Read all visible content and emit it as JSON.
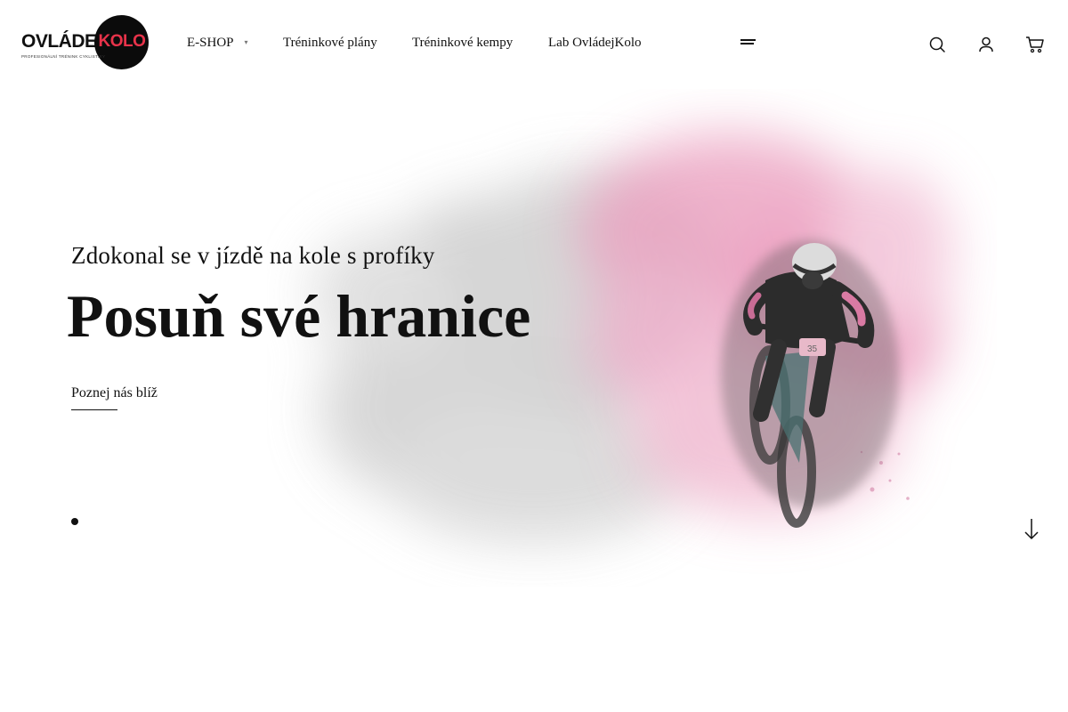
{
  "header": {
    "logo": {
      "text_left": "OVLÁDEJ",
      "text_right": "KOLO",
      "tagline": "PROFESIONÁLNÍ TRÉNINK CYKLISTIKY",
      "brand_color": "#e8334a"
    },
    "nav": {
      "eshop": "E-SHOP",
      "eshop_caret": "▾",
      "plans": "Tréninkové plány",
      "camps": "Tréninkové kempy",
      "lab": "Lab OvládejKolo"
    },
    "icons": {
      "menu": "menu-icon",
      "search": "search-icon",
      "account": "user-icon",
      "cart": "cart-icon"
    }
  },
  "hero": {
    "subtitle": "Zdokonal se v jízdě na kole s profíky",
    "headline": "Posuň své hranice",
    "cta_label": "Poznej nás blíž",
    "rider_number": "35",
    "powder_colors": [
      "#e88fb4",
      "#bdbdbd"
    ],
    "slider": {
      "active_index": 1,
      "count": 1
    },
    "scroll_icon": "arrow-down-icon"
  }
}
